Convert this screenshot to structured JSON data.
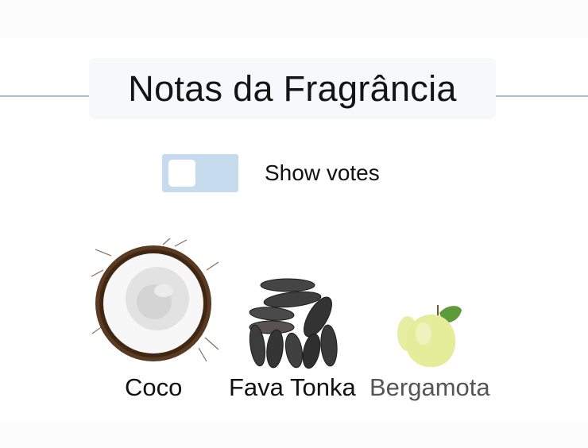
{
  "header": {
    "title": "Notas da Fragrância"
  },
  "votes_toggle": {
    "label": "Show votes",
    "checked": false
  },
  "notes": [
    {
      "name": "Coco",
      "icon": "coconut-image"
    },
    {
      "name": "Fava Tonka",
      "icon": "tonka-bean-image"
    },
    {
      "name": "Bergamota",
      "icon": "bergamot-image"
    }
  ]
}
